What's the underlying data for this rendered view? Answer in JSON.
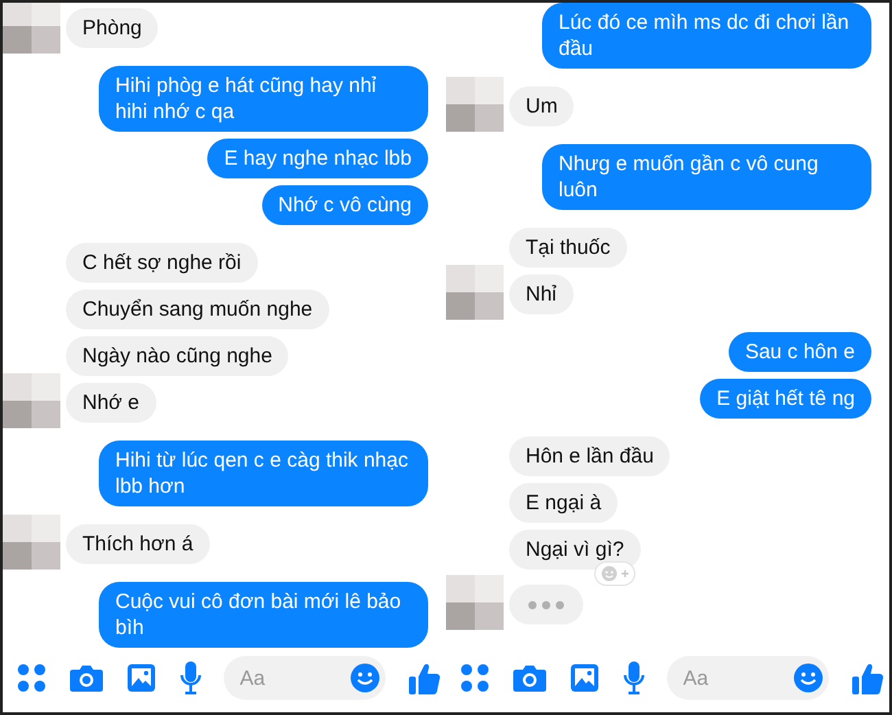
{
  "panels": [
    {
      "messages": [
        {
          "kind": "received",
          "text": "Phòng",
          "avatar": true
        },
        {
          "kind": "sent",
          "text": "Hihi phòg e hát cũng hay nhỉ hihi nhớ c qa"
        },
        {
          "kind": "sent",
          "text": "E hay nghe nhạc lbb"
        },
        {
          "kind": "sent",
          "text": "Nhớ c vô cùng"
        },
        {
          "kind": "received",
          "text": "C hết sợ nghe rồi",
          "avatar": false
        },
        {
          "kind": "received",
          "text": "Chuyển sang muốn nghe",
          "avatar": false
        },
        {
          "kind": "received",
          "text": "Ngày nào cũng nghe",
          "avatar": false
        },
        {
          "kind": "received",
          "text": "Nhớ e",
          "avatar": true
        },
        {
          "kind": "sent",
          "text": "Hihi từ lúc qen c e càg thik nhạc lbb hơn"
        },
        {
          "kind": "received",
          "text": "Thích hơn á",
          "avatar": true
        },
        {
          "kind": "sent",
          "text": "Cuộc vui cô đơn bài mới lê bảo bìh"
        }
      ],
      "composer": {
        "placeholder": "Aa"
      }
    },
    {
      "messages": [
        {
          "kind": "sent",
          "text": "Lúc đó ce mìh ms dc đi chơi lần đầu"
        },
        {
          "kind": "received",
          "text": "Um",
          "avatar": true
        },
        {
          "kind": "sent",
          "text": "Nhưg e muốn gần c vô cung luôn"
        },
        {
          "kind": "received",
          "text": "Tại thuốc",
          "avatar": false
        },
        {
          "kind": "received",
          "text": "Nhỉ",
          "avatar": true
        },
        {
          "kind": "sent",
          "text": "Sau c hôn e"
        },
        {
          "kind": "sent",
          "text": "E giật hết tê ng"
        },
        {
          "kind": "received",
          "text": "Hôn e lần đầu",
          "avatar": false
        },
        {
          "kind": "received",
          "text": "E ngại à",
          "avatar": false
        },
        {
          "kind": "received",
          "text": "Ngại vì gì?",
          "avatar": false,
          "reaction_button": true
        },
        {
          "kind": "typing",
          "avatar": true
        }
      ],
      "composer": {
        "placeholder": "Aa"
      }
    }
  ]
}
